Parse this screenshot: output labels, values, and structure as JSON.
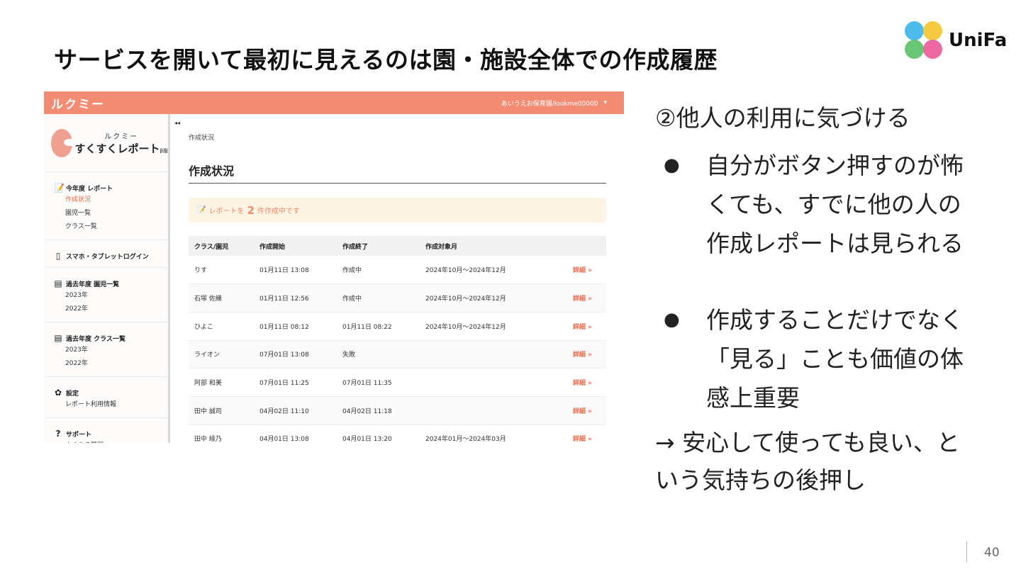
{
  "slide": {
    "title": "サービスを開いて最初に見えるのは園・施設全体での作成履歴",
    "page_number": "40",
    "logo_text": "UniFa"
  },
  "app": {
    "header": {
      "logo": "ルクミー",
      "account": "あいうえお保育園/lookme00000",
      "account_chevron": "▾"
    },
    "sidebar": {
      "brand_top": "ルクミー",
      "brand_main": "すくすくレポート",
      "brand_beta": "β版",
      "sections": [
        {
          "icon": "report-icon",
          "glyph": "📝",
          "title": "今年度 レポート",
          "items": [
            "作成状況",
            "園児一覧",
            "クラス一覧"
          ],
          "active_index": 0
        },
        {
          "icon": "phone-icon",
          "glyph": "▯",
          "title": "スマホ・タブレットログイン",
          "items": []
        },
        {
          "icon": "book-icon",
          "glyph": "▤",
          "title": "過去年度 園児一覧",
          "items": [
            "2023年",
            "2022年"
          ]
        },
        {
          "icon": "book-icon",
          "glyph": "▤",
          "title": "過去年度 クラス一覧",
          "items": [
            "2023年",
            "2022年"
          ]
        },
        {
          "icon": "gear-icon",
          "glyph": "✿",
          "title": "設定",
          "items": [
            "レポート利用情報"
          ]
        },
        {
          "icon": "help-icon",
          "glyph": "?",
          "title": "サポート",
          "items": [
            "よくある質問"
          ]
        }
      ]
    },
    "main": {
      "collapse": "◂◂",
      "breadcrumb": "作成状況",
      "heading": "作成状況",
      "notice": {
        "prefix": "レポートを",
        "count": "2",
        "suffix": "件作成中です"
      },
      "table": {
        "headers": [
          "クラス/園児",
          "作成開始",
          "作成終了",
          "作成対象月",
          ""
        ],
        "rows": [
          [
            "りす",
            "01月11日 13:08",
            "作成中",
            "2024年10月〜2024年12月",
            "詳細 »"
          ],
          [
            "石塚 佐織",
            "01月11日 12:56",
            "作成中",
            "2024年10月〜2024年12月",
            "詳細 »"
          ],
          [
            "ひよこ",
            "01月11日 08:12",
            "01月11日 08:22",
            "2024年10月〜2024年12月",
            "詳細 »"
          ],
          [
            "ライオン",
            "07月01日 13:08",
            "失敗",
            "",
            "詳細 »"
          ],
          [
            "阿部 和美",
            "07月01日 11:25",
            "07月01日 11:35",
            "",
            "詳細 »"
          ],
          [
            "田中 誠司",
            "04月02日 11:10",
            "04月02日 11:18",
            "",
            "詳細 »"
          ],
          [
            "田中 綾乃",
            "04月01日 13:08",
            "04月01日 13:20",
            "2024年01月〜2024年03月",
            "詳細 »"
          ]
        ]
      }
    }
  },
  "notes": {
    "point": "②他人の利用に気づける",
    "bullets": [
      "自分がボタン押すのが怖くても、すでに他の人の作成レポートは見られる",
      "作成することだけでなく「見る」ことも価値の体感上重要"
    ],
    "bullet_mark": "●",
    "conclusion": "→ 安心して使っても良い、という気持ちの後押し"
  }
}
